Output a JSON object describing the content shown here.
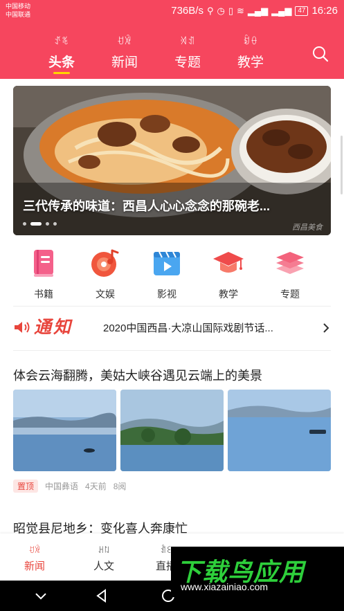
{
  "statusbar": {
    "carrier1": "中国移动",
    "carrier2": "中国联通",
    "speed": "736B/s",
    "battery": "47",
    "time": "16:26"
  },
  "topnav": {
    "tabs": [
      {
        "yi": "ꀋꄖ",
        "label": "头条"
      },
      {
        "yi": "ꀀꑞ",
        "label": "新闻"
      },
      {
        "yi": "ꄉꀊ",
        "label": "专题"
      },
      {
        "yi": "ꀁꂷ",
        "label": "教学"
      }
    ]
  },
  "banner": {
    "caption": "三代传承的味道：西昌人心心念念的那碗老...",
    "watermark_text": "西昌美食"
  },
  "categories": [
    {
      "label": "书籍",
      "icon": "book-icon",
      "color": "#f4608a"
    },
    {
      "label": "文娱",
      "icon": "music-disc-icon",
      "color": "#f0563d"
    },
    {
      "label": "影视",
      "icon": "video-play-icon",
      "color": "#4aa6f0"
    },
    {
      "label": "教学",
      "icon": "graduation-cap-icon",
      "color": "#ef4b4b"
    },
    {
      "label": "专题",
      "icon": "layers-icon",
      "color": "#f3637c"
    }
  ],
  "notice": {
    "title": "通知",
    "text": "2020中国西昌·大凉山国际戏剧节话..."
  },
  "article": {
    "title": "体会云海翻腾，美姑大峡谷遇见云端上的美景",
    "tag": "置顶",
    "source": "中国彝语",
    "time": "4天前",
    "reads": "8阅"
  },
  "article2": {
    "title": "昭觉县尼地乡：变化喜人奔康忙"
  },
  "bottomnav": {
    "items": [
      {
        "yi": "ꀀꑞ",
        "label": "新闻"
      },
      {
        "yi": "ꃅꇁ",
        "label": "人文"
      },
      {
        "yi": "ꀉꏂ",
        "label": "直播"
      }
    ]
  },
  "watermark": {
    "logo": "下载鸟应用",
    "url": "www.xiazainiao.com"
  },
  "colors": {
    "brand": "#f6465e",
    "accent": "#e8453c",
    "underline": "#ffd400",
    "watermark_green": "#2ecf3b"
  }
}
